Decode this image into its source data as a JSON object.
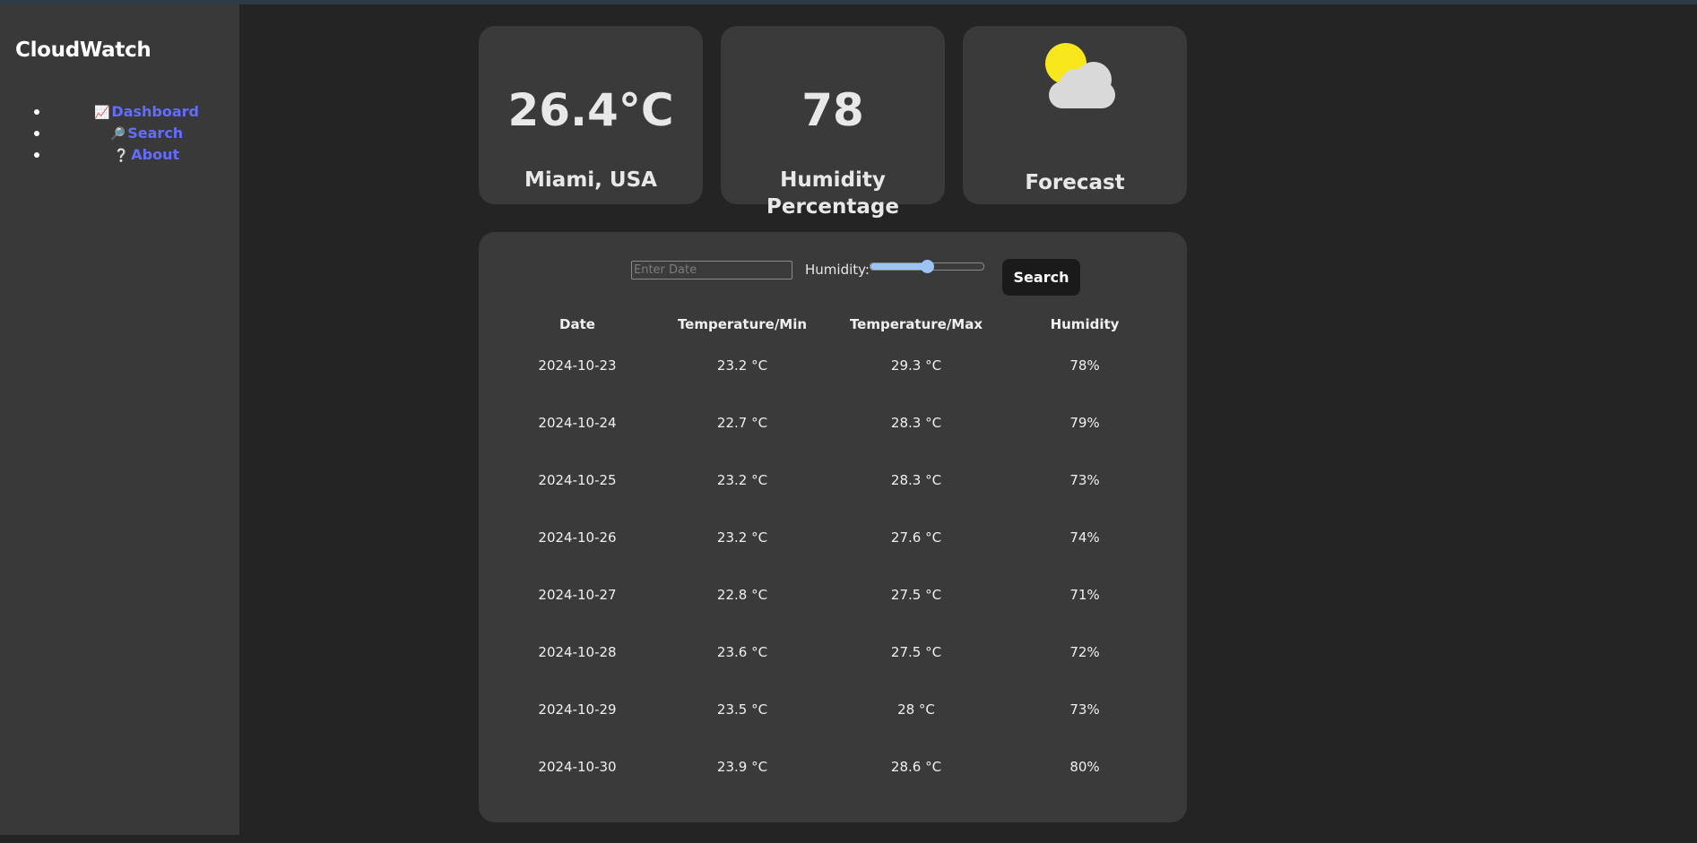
{
  "app": {
    "title": "CloudWatch"
  },
  "nav": [
    {
      "icon": "📈",
      "icon_name": "chart-icon",
      "label": "Dashboard"
    },
    {
      "icon": "🔎",
      "icon_name": "search-icon",
      "label": "Search"
    },
    {
      "icon": "❔",
      "icon_name": "question-icon",
      "label": "About"
    }
  ],
  "cards": {
    "temperature": {
      "value": "26.4°C",
      "label": "Miami, USA"
    },
    "humidity": {
      "value": "78",
      "label": "Humidity Percentage"
    },
    "forecast": {
      "label": "Forecast",
      "icon": "partly-cloudy-icon"
    }
  },
  "filters": {
    "date_placeholder": "Enter Date",
    "humidity_label": "Humidity:",
    "humidity_slider_fraction": 0.5,
    "search_label": "Search"
  },
  "table": {
    "headers": [
      "Date",
      "Temperature/Min",
      "Temperature/Max",
      "Humidity"
    ],
    "rows": [
      [
        "2024-10-23",
        "23.2 °C",
        "29.3 °C",
        "78%"
      ],
      [
        "2024-10-24",
        "22.7 °C",
        "28.3 °C",
        "79%"
      ],
      [
        "2024-10-25",
        "23.2 °C",
        "28.3 °C",
        "73%"
      ],
      [
        "2024-10-26",
        "23.2 °C",
        "27.6 °C",
        "74%"
      ],
      [
        "2024-10-27",
        "22.8 °C",
        "27.5 °C",
        "71%"
      ],
      [
        "2024-10-28",
        "23.6 °C",
        "27.5 °C",
        "72%"
      ],
      [
        "2024-10-29",
        "23.5 °C",
        "28 °C",
        "73%"
      ],
      [
        "2024-10-30",
        "23.9 °C",
        "28.6 °C",
        "80%"
      ]
    ]
  },
  "colors": {
    "accent": "#646cff",
    "background": "#242424",
    "sidebar": "#393939",
    "card": "#3a3a3a",
    "slider": "#9cc3f5",
    "sun": "#f8e71c"
  }
}
